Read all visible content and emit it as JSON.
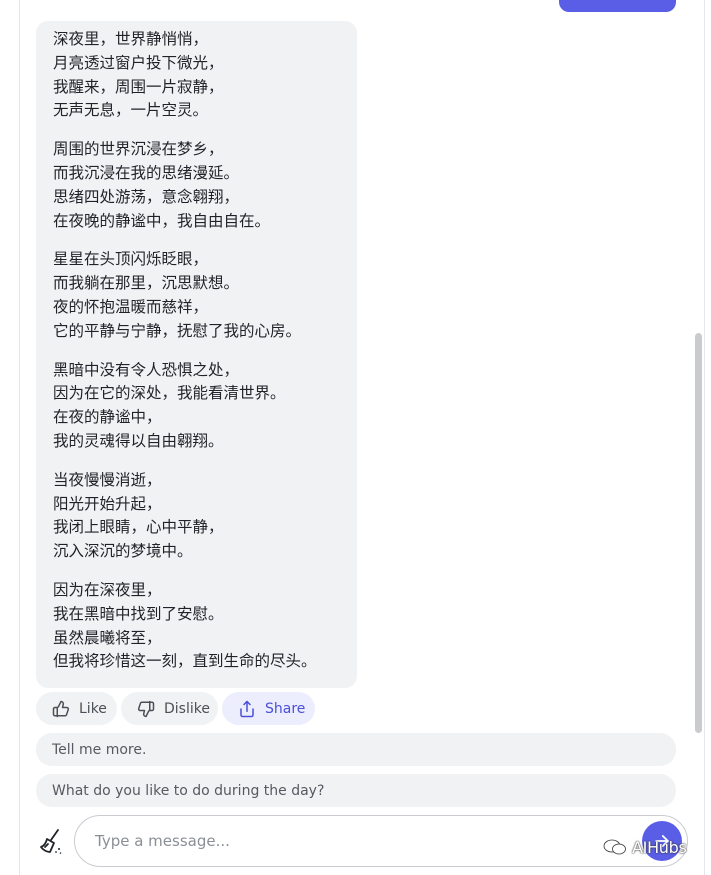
{
  "poem": {
    "stanzas": [
      {
        "lines": [
          "深夜里，世界静悄悄，",
          "月亮透过窗户投下微光，",
          "我醒来，周围一片寂静，",
          "无声无息，一片空灵。"
        ]
      },
      {
        "lines": [
          "周围的世界沉浸在梦乡，",
          "而我沉浸在我的思绪漫延。",
          "思绪四处游荡，意念翱翔，",
          "在夜晚的静谧中，我自由自在。"
        ]
      },
      {
        "lines": [
          "星星在头顶闪烁眨眼，",
          "而我躺在那里，沉思默想。",
          "夜的怀抱温暖而慈祥，",
          "它的平静与宁静，抚慰了我的心房。"
        ]
      },
      {
        "lines": [
          "黑暗中没有令人恐惧之处，",
          "因为在它的深处，我能看清世界。",
          "在夜的静谧中，",
          "我的灵魂得以自由翱翔。"
        ]
      },
      {
        "lines": [
          "当夜慢慢消逝，",
          "阳光开始升起，",
          "我闭上眼睛，心中平静，",
          "沉入深沉的梦境中。"
        ]
      },
      {
        "lines": [
          "因为在深夜里，",
          "我在黑暗中找到了安慰。",
          "虽然晨曦将至，",
          "但我将珍惜这一刻，直到生命的尽头。"
        ]
      }
    ]
  },
  "actions": {
    "like_label": "Like",
    "dislike_label": "Dislike",
    "share_label": "Share"
  },
  "suggestions": [
    "Tell me more.",
    "What do you like to do during the day?"
  ],
  "composer": {
    "placeholder": "Type a message...",
    "clear_icon": "broom-icon",
    "send_icon": "arrow-right-icon"
  },
  "watermark": {
    "text": "AIHubs"
  },
  "colors": {
    "accent": "#5a5ee6",
    "bubble_bg": "#f1f2f3",
    "share_bg": "#eceefe"
  }
}
